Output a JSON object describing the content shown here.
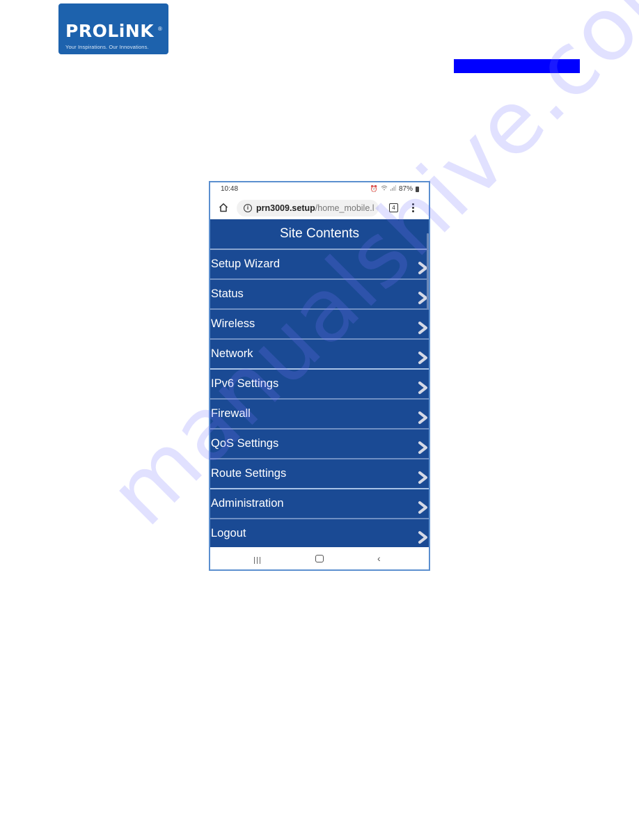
{
  "brand": {
    "logo_text": "PROLiNK",
    "registered_mark": "®",
    "tagline": "Your Inspirations. Our Innovations.",
    "logo_color": "#1d62ad"
  },
  "header_bar_color": "#0000ff",
  "phone": {
    "status_bar": {
      "time": "10:48",
      "icons": [
        "alarm-icon",
        "wifi-icon",
        "signal-icon"
      ],
      "battery": "87%"
    },
    "browser": {
      "url_host": "prn3009.setup",
      "url_path": "/home_mobile.l",
      "tab_count": "4"
    },
    "page": {
      "title": "Site Contents",
      "background_color": "#1a4a94",
      "menu_items": [
        {
          "label": "Setup Wizard"
        },
        {
          "label": "Status"
        },
        {
          "label": "Wireless"
        },
        {
          "label": "Network"
        },
        {
          "label": "IPv6 Settings"
        },
        {
          "label": "Firewall"
        },
        {
          "label": "QoS Settings"
        },
        {
          "label": "Route Settings"
        },
        {
          "label": "Administration"
        },
        {
          "label": "Logout"
        }
      ]
    },
    "nav_bar": {
      "back_glyph": "‹"
    }
  },
  "watermark": "manualshive.com"
}
